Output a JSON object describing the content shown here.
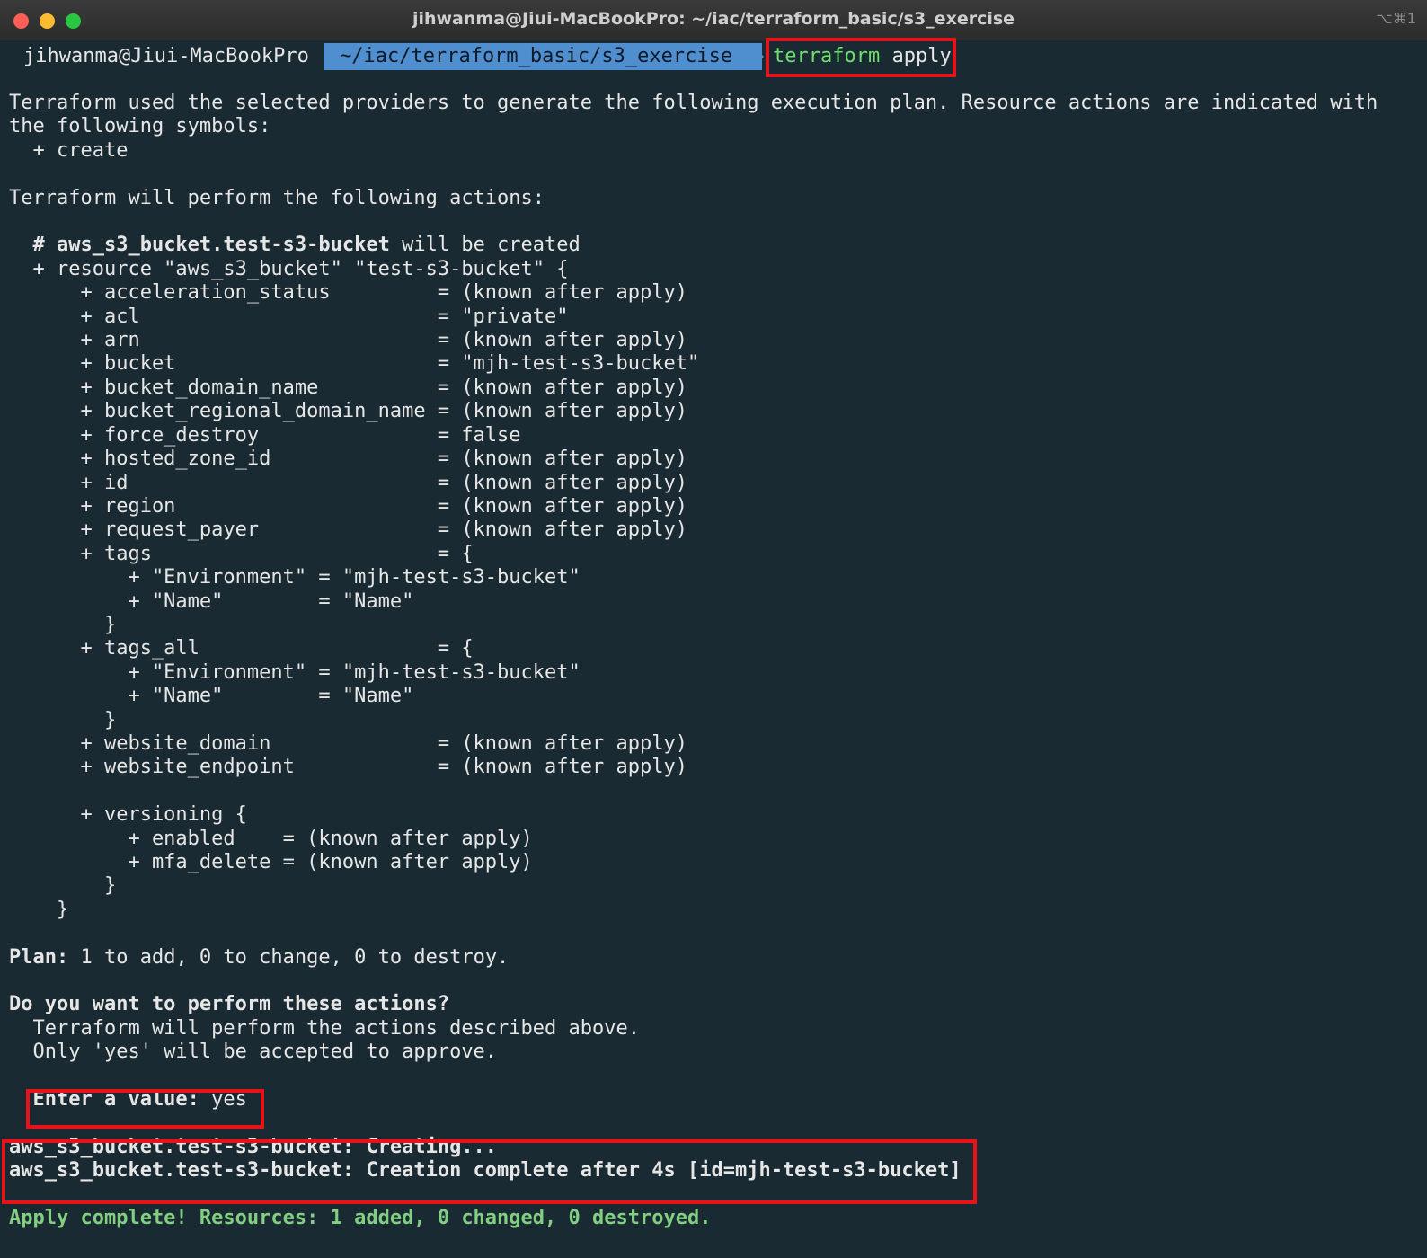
{
  "window": {
    "title": "jihwanma@Jiui-MacBookPro: ~/iac/terraform_basic/s3_exercise",
    "shortcut": "⌥⌘1"
  },
  "prompt": {
    "user_host": "jihwanma@Jiui-MacBookPro",
    "path": "~/iac/terraform_basic/s3_exercise",
    "command": "terraform",
    "command_arg": "apply"
  },
  "output": {
    "intro_1": "Terraform used the selected providers to generate the following execution plan. Resource actions are indicated with",
    "intro_2": "the following symbols:",
    "create_symbol": "  + create",
    "blank": "",
    "will_perform": "Terraform will perform the following actions:",
    "resource_comment_hash": "  # ",
    "resource_comment_name": "aws_s3_bucket.test-s3-bucket",
    "resource_comment_rest": " will be created",
    "resource_open": "  + resource \"aws_s3_bucket\" \"test-s3-bucket\" {",
    "attrs": [
      "      + acceleration_status         = (known after apply)",
      "      + acl                         = \"private\"",
      "      + arn                         = (known after apply)",
      "      + bucket                      = \"mjh-test-s3-bucket\"",
      "      + bucket_domain_name          = (known after apply)",
      "      + bucket_regional_domain_name = (known after apply)",
      "      + force_destroy               = false",
      "      + hosted_zone_id              = (known after apply)",
      "      + id                          = (known after apply)",
      "      + region                      = (known after apply)",
      "      + request_payer               = (known after apply)",
      "      + tags                        = {",
      "          + \"Environment\" = \"mjh-test-s3-bucket\"",
      "          + \"Name\"        = \"Name\"",
      "        }",
      "      + tags_all                    = {",
      "          + \"Environment\" = \"mjh-test-s3-bucket\"",
      "          + \"Name\"        = \"Name\"",
      "        }",
      "      + website_domain              = (known after apply)",
      "      + website_endpoint            = (known after apply)",
      "",
      "      + versioning {",
      "          + enabled    = (known after apply)",
      "          + mfa_delete = (known after apply)",
      "        }",
      "    }"
    ],
    "plan_label": "Plan:",
    "plan_rest": " 1 to add, 0 to change, 0 to destroy.",
    "confirm_question": "Do you want to perform these actions?",
    "confirm_line_1": "  Terraform will perform the actions described above.",
    "confirm_line_2": "  Only 'yes' will be accepted to approve.",
    "enter_label": "  Enter a value: ",
    "enter_value": "yes",
    "creating_line": "aws_s3_bucket.test-s3-bucket: Creating...",
    "complete_line": "aws_s3_bucket.test-s3-bucket: Creation complete after 4s [id=mjh-test-s3-bucket]",
    "apply_complete": "Apply complete! Resources: 1 added, 0 changed, 0 destroyed."
  },
  "colors": {
    "background": "#1a2a33",
    "highlight_border": "#e8121a",
    "path_segment": "#4f8fd0",
    "success_green": "#82cf82"
  }
}
